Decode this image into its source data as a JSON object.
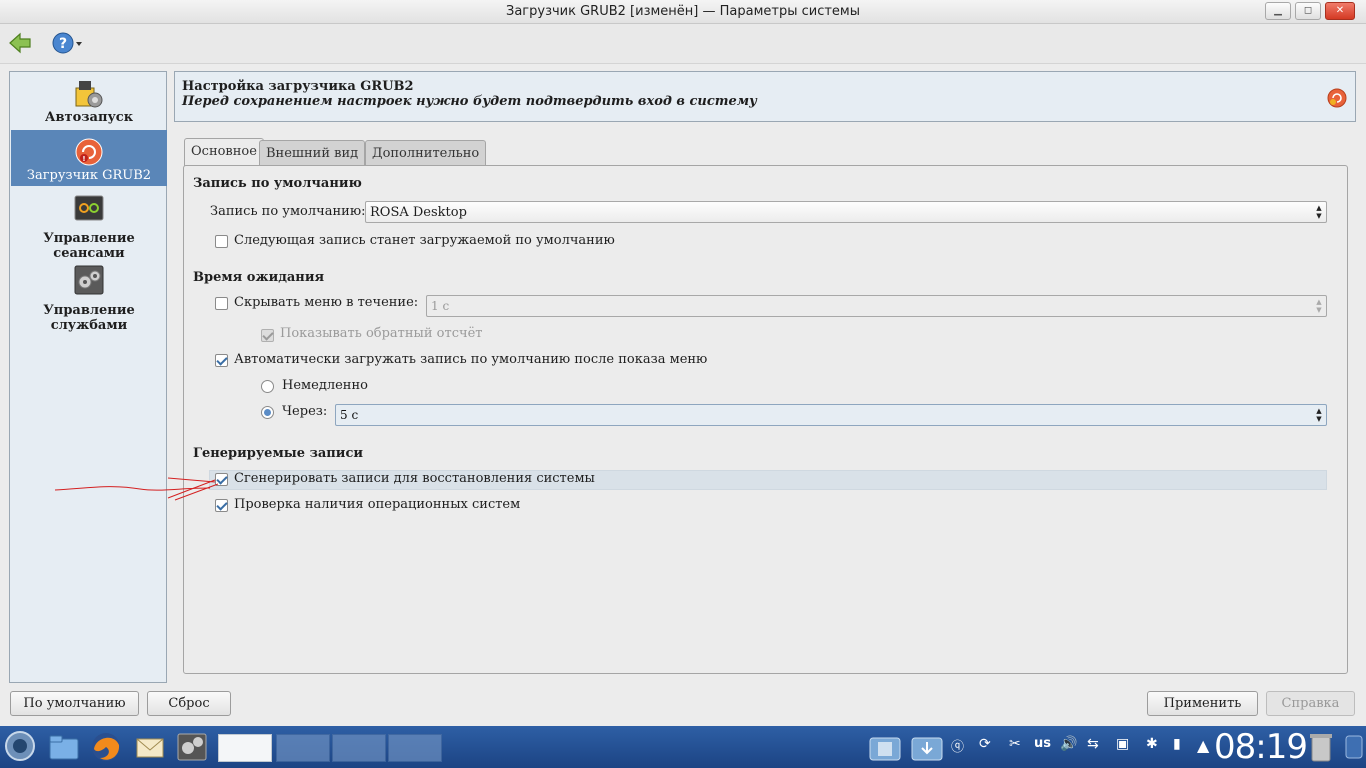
{
  "window": {
    "title": "Загрузчик GRUB2 [изменён] — Параметры системы",
    "min_glyph": "▁",
    "max_glyph": "◻",
    "close_glyph": "✕"
  },
  "sidebar": {
    "items": [
      {
        "label": "Автозапуск",
        "icon": "autostart-icon"
      },
      {
        "label": "Загрузчик GRUB2",
        "icon": "grub-icon"
      },
      {
        "label": "Управление сеансами",
        "icon": "session-icon"
      },
      {
        "label": "Управление службами",
        "icon": "services-icon"
      }
    ]
  },
  "header": {
    "title": "Настройка загрузчика GRUB2",
    "subtitle": "Перед сохранением настроек нужно будет подтвердить вход в систему"
  },
  "tabs": [
    "Основное",
    "Внешний вид",
    "Дополнительно"
  ],
  "default_entry": {
    "section": "Запись по умолчанию",
    "label": "Запись по умолчанию:",
    "value": "ROSA Desktop",
    "next_boot_label": "Следующая запись станет загружаемой по умолчанию"
  },
  "timeout": {
    "section": "Время ожидания",
    "hide_menu_label": "Скрывать меню в течение:",
    "hide_menu_value": "1 с",
    "countdown_label": "Показывать обратный отсчёт",
    "auto_boot_label": "Автоматически загружать запись по умолчанию после показа меню",
    "immediately_label": "Немедленно",
    "after_label": "Через:",
    "after_value": "5 с"
  },
  "generated": {
    "section": "Генерируемые записи",
    "recovery_label": "Сгенерировать записи для восстановления системы",
    "os_prober_label": "Проверка наличия операционных систем"
  },
  "buttons": {
    "defaults": "По умолчанию",
    "reset": "Сброс",
    "apply": "Применить",
    "help": "Справка"
  },
  "taskbar": {
    "clock": "08:19",
    "layout": "us"
  },
  "colors": {
    "selection": "#5a86b8",
    "taskbar": "#1c4484",
    "annotation_arrow": "#d42020"
  }
}
